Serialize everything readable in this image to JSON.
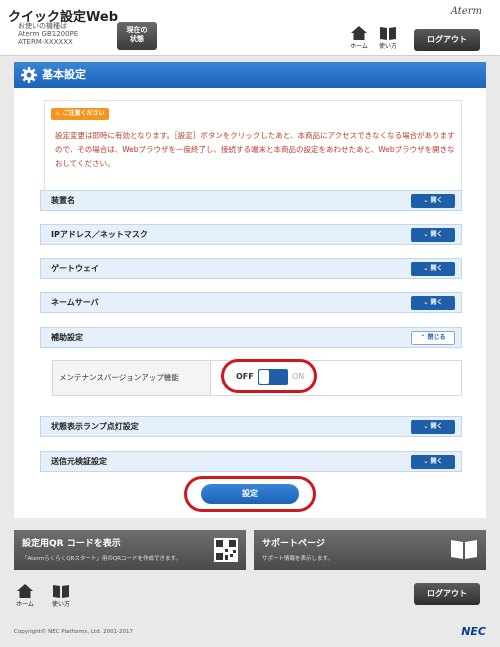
{
  "header": {
    "app_title": "クイック設定Web",
    "device_label": "お使いの機種は",
    "device_model": "Aterm GB1200PE",
    "device_name": "ATERM-XXXXXX",
    "status_button": "現在の\n状態",
    "brand": "Aterm",
    "home_label": "ホーム",
    "help_label": "使い方",
    "logout_label": "ログアウト"
  },
  "panel": {
    "title": "基本設定",
    "notice_badge": "ご注意ください",
    "notice_text": "設定変更は即時に有効となります。［設定］ボタンをクリックしたあと、本商品にアクセスできなくなる場合がありますので、その場合は、Webブラウザを一度終了し、接続する端末と本商品の設定をあわせたあと、Webブラウザを開きなおしてください。",
    "sections": [
      {
        "label": "装置名",
        "toggle": "開く"
      },
      {
        "label": "IPアドレス／ネットマスク",
        "toggle": "開く"
      },
      {
        "label": "ゲートウェイ",
        "toggle": "開く"
      },
      {
        "label": "ネームサーバ",
        "toggle": "開く"
      },
      {
        "label": "補助設定",
        "toggle": "閉じる"
      },
      {
        "label": "状態表示ランプ点灯設定",
        "toggle": "開く"
      },
      {
        "label": "送信元検証設定",
        "toggle": "開く"
      }
    ],
    "maintenance": {
      "label": "メンテナンスバージョンアップ機能",
      "off_label": "OFF",
      "on_label": "ON",
      "state": "OFF"
    },
    "submit_label": "設定"
  },
  "cards": {
    "qr": {
      "title": "設定用QR コードを表示",
      "subtitle": "「AtermらくらくQRスタート」用のQRコードを作成できます。"
    },
    "support": {
      "title": "サポートページ",
      "subtitle": "サポート情報を表示します。"
    }
  },
  "footer": {
    "home_label": "ホーム",
    "help_label": "使い方",
    "logout_label": "ログアウト",
    "copyright": "Copyright© NEC Platforms, Ltd. 2001-2017",
    "logo": "NEC"
  },
  "colors": {
    "accent": "#1f5fa8",
    "highlight": "#d0181c",
    "notice": "#c0392b"
  }
}
